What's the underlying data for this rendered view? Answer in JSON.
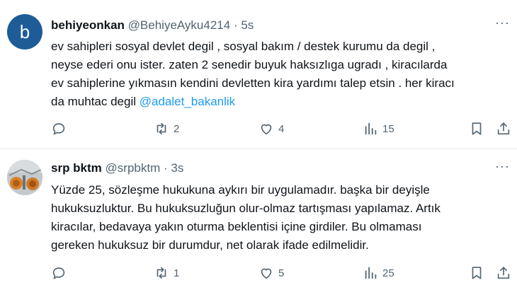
{
  "tweets": [
    {
      "avatar_letter": "b",
      "display_name": "behiyeonkan",
      "handle": "@BehiyeAyku4214",
      "separator": "·",
      "time": "5s",
      "more_icon": "more-dots-icon",
      "text_lines": [
        "ev sahipleri sosyal devlet degil , sosyal bakım / destek kurumu da degil ,",
        "neyse ederi onu ister. zaten 2 senedir buyuk haksızlıga ugradı , kiracılarda",
        "ev sahiplerine yıkmasın kendini devletten kira yardımı talep etsin . her kiracı",
        "da muhtac degil "
      ],
      "mention": "@adalet_bakanlik",
      "replies": "",
      "retweets": "2",
      "likes": "4",
      "views": "15"
    },
    {
      "display_name": "srp bktm",
      "handle": "@srpbktm",
      "separator": "·",
      "time": "3s",
      "more_icon": "more-dots-icon",
      "text_lines": [
        "Yüzde 25, sözleşme hukukuna aykırı bir uygulamadır. başka bir deyişle",
        "hukuksuzluktur. Bu hukuksuzluğun olur-olmaz tartışması yapılamaz. Artık",
        "kiracılar, bedavaya yakın oturma beklentisi içine girdiler. Bu olmaması",
        "gereken hukuksuz bir durumdur, net olarak ifade edilmelidir."
      ],
      "replies": "",
      "retweets": "1",
      "likes": "5",
      "views": "25"
    }
  ],
  "colors": {
    "text": "#0f1419",
    "muted": "#536471",
    "link": "#1d9bf0",
    "avatar_b": "#1d5c96"
  },
  "icons": [
    "reply-icon",
    "retweet-icon",
    "like-icon",
    "views-icon",
    "bookmark-icon",
    "share-icon"
  ]
}
